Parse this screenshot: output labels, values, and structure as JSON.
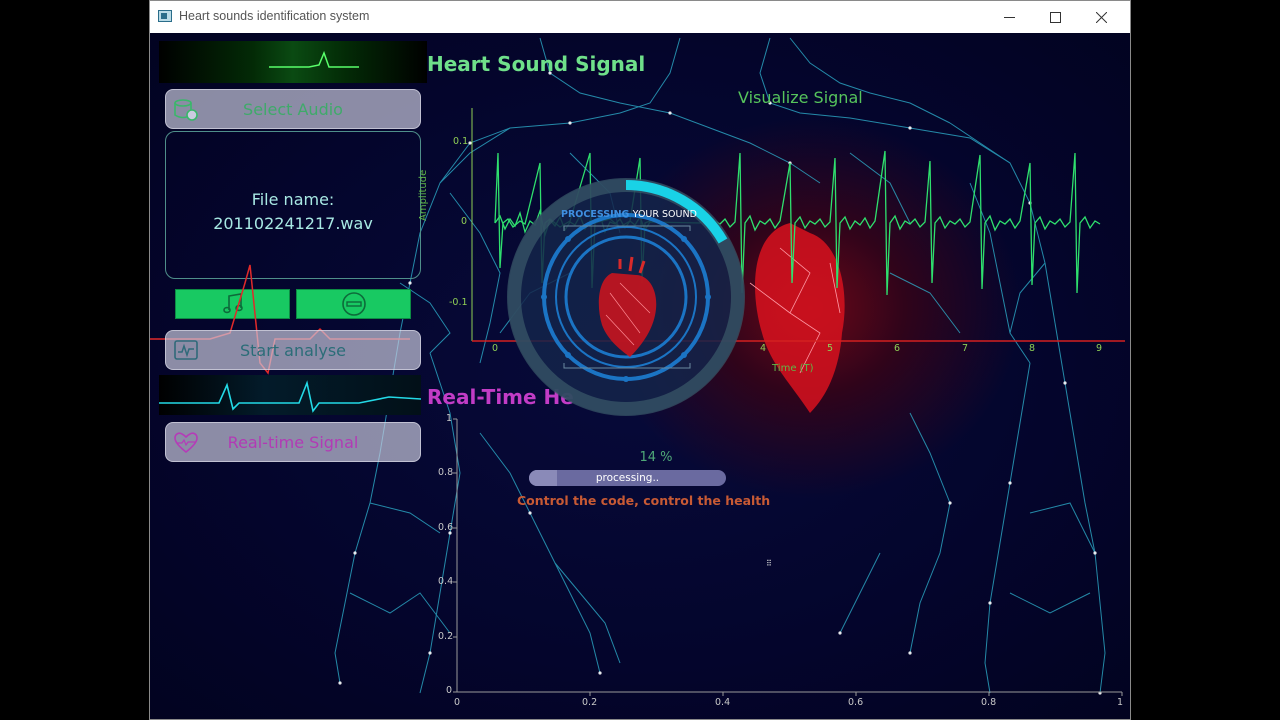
{
  "window": {
    "title": "Heart sounds identification system",
    "controls": [
      "minimize",
      "maximize",
      "close"
    ]
  },
  "sidebar": {
    "select_audio_label": "Select Audio",
    "file_label": "File name:",
    "file_name": "201102241217.wav",
    "start_analyse_label": "Start analyse",
    "realtime_signal_label": "Real-time Signal",
    "icons": [
      "database-audio-icon",
      "music-note-icon",
      "no-entry-icon",
      "signal-monitor-icon",
      "heart-pulse-icon"
    ]
  },
  "headings": {
    "heart_sound_signal": "Heart Sound Signal",
    "realtime_heart": "Real-Time He",
    "visualize_signal": "Visualize Signal"
  },
  "signal_plot": {
    "ylabel": "Amplitude",
    "xlabel": "Time (T)",
    "yticks": [
      "0.1",
      "0",
      "-0.1"
    ],
    "xticks": [
      "0",
      "4",
      "5",
      "6",
      "7",
      "8",
      "9"
    ]
  },
  "realtime_plot": {
    "yticks": [
      "1",
      "0.8",
      "0.6",
      "0.4",
      "0.2",
      "0"
    ],
    "xticks": [
      "0",
      "0.2",
      "0.4",
      "0.6",
      "0.8",
      "1"
    ]
  },
  "processing": {
    "ring_word_1": "PROCESSING",
    "ring_word_2": "YOUR SOUND",
    "percent_text": "14 %",
    "progress": 0.14,
    "bar_text": "processing..",
    "tagline": "Control the code, control the health"
  },
  "colors": {
    "accent_green": "#6fe08a",
    "accent_purple": "#c23cc6",
    "button_green": "#18c962",
    "ring_cyan": "#19d2e6"
  }
}
